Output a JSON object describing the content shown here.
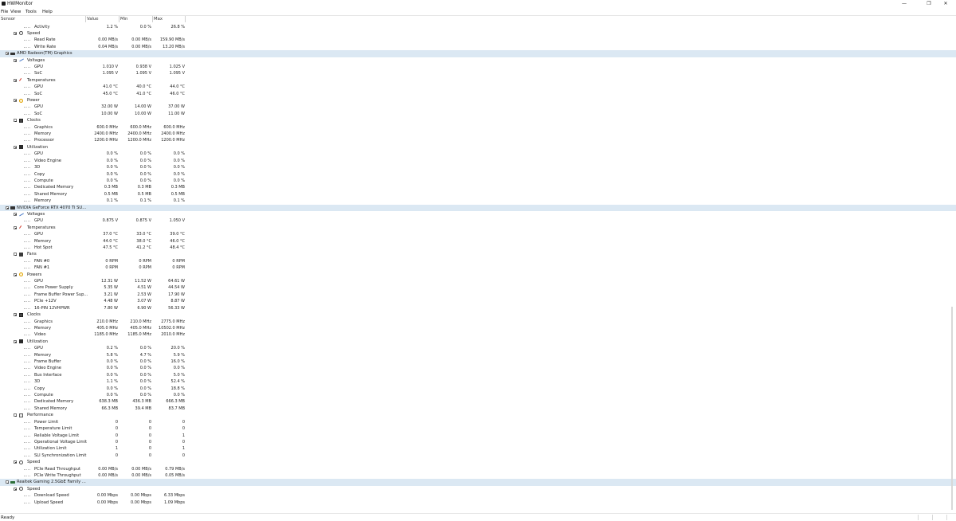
{
  "window": {
    "title": "HWMonitor",
    "minimize": "—",
    "maximize": "❐",
    "close": "✕"
  },
  "menu": [
    "File",
    "View",
    "Tools",
    "Help"
  ],
  "columns": {
    "sensor": "Sensor",
    "value": "Value",
    "min": "Min",
    "max": "Max"
  },
  "rows": [
    {
      "kind": "sensor",
      "indent": 3,
      "label": "Activity",
      "value": "1.2 %",
      "min": "0.0 %",
      "max": "26.8 %"
    },
    {
      "kind": "group",
      "icon": "speed-icon",
      "label": "Speed"
    },
    {
      "kind": "sensor",
      "indent": 3,
      "label": "Read Rate",
      "value": "0.00 MB/s",
      "min": "0.00 MB/s",
      "max": "159.90 MB/s"
    },
    {
      "kind": "sensor",
      "indent": 3,
      "label": "Write Rate",
      "value": "0.04 MB/s",
      "min": "0.00 MB/s",
      "max": "13.20 MB/s"
    },
    {
      "kind": "device",
      "icon": "gpu-card-icon",
      "label": "AMD Radeon(TM) Graphics"
    },
    {
      "kind": "group",
      "icon": "voltage-icon",
      "label": "Voltages"
    },
    {
      "kind": "sensor",
      "indent": 3,
      "label": "GPU",
      "value": "1.010 V",
      "min": "0.938 V",
      "max": "1.025 V"
    },
    {
      "kind": "sensor",
      "indent": 3,
      "label": "SoC",
      "value": "1.095 V",
      "min": "1.095 V",
      "max": "1.095 V"
    },
    {
      "kind": "group",
      "icon": "temperature-icon",
      "label": "Temperatures"
    },
    {
      "kind": "sensor",
      "indent": 3,
      "label": "GPU",
      "value": "41.0 °C",
      "min": "40.0 °C",
      "max": "44.0 °C"
    },
    {
      "kind": "sensor",
      "indent": 3,
      "label": "SoC",
      "value": "45.0 °C",
      "min": "41.0 °C",
      "max": "46.0 °C"
    },
    {
      "kind": "group",
      "icon": "power-icon",
      "label": "Power"
    },
    {
      "kind": "sensor",
      "indent": 3,
      "label": "GPU",
      "value": "32.00 W",
      "min": "14.00 W",
      "max": "37.00 W"
    },
    {
      "kind": "sensor",
      "indent": 3,
      "label": "SoC",
      "value": "10.00 W",
      "min": "10.00 W",
      "max": "11.00 W"
    },
    {
      "kind": "group",
      "icon": "clock-icon",
      "label": "Clocks"
    },
    {
      "kind": "sensor",
      "indent": 3,
      "label": "Graphics",
      "value": "600.0 MHz",
      "min": "600.0 MHz",
      "max": "600.0 MHz"
    },
    {
      "kind": "sensor",
      "indent": 3,
      "label": "Memory",
      "value": "2400.0 MHz",
      "min": "2400.0 MHz",
      "max": "2400.0 MHz"
    },
    {
      "kind": "sensor",
      "indent": 3,
      "label": "Processor",
      "value": "1200.0 MHz",
      "min": "1200.0 MHz",
      "max": "1200.0 MHz"
    },
    {
      "kind": "group",
      "icon": "utilization-icon",
      "label": "Utilization"
    },
    {
      "kind": "sensor",
      "indent": 3,
      "label": "GPU",
      "value": "0.0 %",
      "min": "0.0 %",
      "max": "0.0 %"
    },
    {
      "kind": "sensor",
      "indent": 3,
      "label": "Video Engine",
      "value": "0.0 %",
      "min": "0.0 %",
      "max": "0.0 %"
    },
    {
      "kind": "sensor",
      "indent": 3,
      "label": "3D",
      "value": "0.0 %",
      "min": "0.0 %",
      "max": "0.0 %"
    },
    {
      "kind": "sensor",
      "indent": 3,
      "label": "Copy",
      "value": "0.0 %",
      "min": "0.0 %",
      "max": "0.0 %"
    },
    {
      "kind": "sensor",
      "indent": 3,
      "label": "Compute",
      "value": "0.0 %",
      "min": "0.0 %",
      "max": "0.0 %"
    },
    {
      "kind": "sensor",
      "indent": 3,
      "label": "Dedicated Memory",
      "value": "0.3 MB",
      "min": "0.3 MB",
      "max": "0.3 MB"
    },
    {
      "kind": "sensor",
      "indent": 3,
      "label": "Shared Memory",
      "value": "0.5 MB",
      "min": "0.5 MB",
      "max": "0.5 MB"
    },
    {
      "kind": "sensor",
      "indent": 3,
      "label": "Memory",
      "value": "0.1 %",
      "min": "0.1 %",
      "max": "0.1 %"
    },
    {
      "kind": "device",
      "icon": "gpu-card-icon",
      "label": "NVIDIA GeForce RTX 4070 Ti SU..."
    },
    {
      "kind": "group",
      "icon": "voltage-icon",
      "label": "Voltages"
    },
    {
      "kind": "sensor",
      "indent": 3,
      "label": "GPU",
      "value": "0.875 V",
      "min": "0.875 V",
      "max": "1.050 V"
    },
    {
      "kind": "group",
      "icon": "temperature-icon",
      "label": "Temperatures"
    },
    {
      "kind": "sensor",
      "indent": 3,
      "label": "GPU",
      "value": "37.0 °C",
      "min": "33.0 °C",
      "max": "39.0 °C"
    },
    {
      "kind": "sensor",
      "indent": 3,
      "label": "Memory",
      "value": "44.0 °C",
      "min": "38.0 °C",
      "max": "46.0 °C"
    },
    {
      "kind": "sensor",
      "indent": 3,
      "label": "Hot Spot",
      "value": "47.5 °C",
      "min": "41.2 °C",
      "max": "48.4 °C"
    },
    {
      "kind": "group",
      "icon": "fan-icon",
      "label": "Fans"
    },
    {
      "kind": "sensor",
      "indent": 3,
      "label": "FAN #0",
      "value": "0 RPM",
      "min": "0 RPM",
      "max": "0 RPM"
    },
    {
      "kind": "sensor",
      "indent": 3,
      "label": "FAN #1",
      "value": "0 RPM",
      "min": "0 RPM",
      "max": "0 RPM"
    },
    {
      "kind": "group",
      "icon": "power-icon",
      "label": "Powers"
    },
    {
      "kind": "sensor",
      "indent": 3,
      "label": "GPU",
      "value": "12.31 W",
      "min": "11.52 W",
      "max": "64.61 W"
    },
    {
      "kind": "sensor",
      "indent": 3,
      "label": "Core Power Supply",
      "value": "5.35 W",
      "min": "4.51 W",
      "max": "44.54 W"
    },
    {
      "kind": "sensor",
      "indent": 3,
      "label": "Frame Buffer Power Sup...",
      "value": "3.21 W",
      "min": "2.53 W",
      "max": "17.90 W"
    },
    {
      "kind": "sensor",
      "indent": 3,
      "label": "PCIe +12V",
      "value": "4.48 W",
      "min": "3.07 W",
      "max": "8.87 W"
    },
    {
      "kind": "sensor",
      "indent": 3,
      "label": "16-PIN 12VHPWR",
      "value": "7.80 W",
      "min": "6.90 W",
      "max": "56.33 W"
    },
    {
      "kind": "group",
      "icon": "clock-icon",
      "label": "Clocks"
    },
    {
      "kind": "sensor",
      "indent": 3,
      "label": "Graphics",
      "value": "210.0 MHz",
      "min": "210.0 MHz",
      "max": "2775.0 MHz"
    },
    {
      "kind": "sensor",
      "indent": 3,
      "label": "Memory",
      "value": "405.0 MHz",
      "min": "405.0 MHz",
      "max": "10502.0 MHz"
    },
    {
      "kind": "sensor",
      "indent": 3,
      "label": "Video",
      "value": "1185.0 MHz",
      "min": "1185.0 MHz",
      "max": "2010.0 MHz"
    },
    {
      "kind": "group",
      "icon": "utilization-icon",
      "label": "Utilization"
    },
    {
      "kind": "sensor",
      "indent": 3,
      "label": "GPU",
      "value": "0.2 %",
      "min": "0.0 %",
      "max": "20.0 %"
    },
    {
      "kind": "sensor",
      "indent": 3,
      "label": "Memory",
      "value": "5.8 %",
      "min": "4.7 %",
      "max": "5.9 %"
    },
    {
      "kind": "sensor",
      "indent": 3,
      "label": "Frame Buffer",
      "value": "0.0 %",
      "min": "0.0 %",
      "max": "16.0 %"
    },
    {
      "kind": "sensor",
      "indent": 3,
      "label": "Video Engine",
      "value": "0.0 %",
      "min": "0.0 %",
      "max": "0.0 %"
    },
    {
      "kind": "sensor",
      "indent": 3,
      "label": "Bus Interface",
      "value": "0.0 %",
      "min": "0.0 %",
      "max": "5.0 %"
    },
    {
      "kind": "sensor",
      "indent": 3,
      "label": "3D",
      "value": "1.1 %",
      "min": "0.0 %",
      "max": "52.4 %"
    },
    {
      "kind": "sensor",
      "indent": 3,
      "label": "Copy",
      "value": "0.0 %",
      "min": "0.0 %",
      "max": "18.8 %"
    },
    {
      "kind": "sensor",
      "indent": 3,
      "label": "Compute",
      "value": "0.0 %",
      "min": "0.0 %",
      "max": "0.0 %"
    },
    {
      "kind": "sensor",
      "indent": 3,
      "label": "Dedicated Memory",
      "value": "638.3 MB",
      "min": "436.3 MB",
      "max": "666.3 MB"
    },
    {
      "kind": "sensor",
      "indent": 3,
      "label": "Shared Memory",
      "value": "66.3 MB",
      "min": "39.4 MB",
      "max": "83.7 MB"
    },
    {
      "kind": "group",
      "icon": "performance-icon",
      "label": "Performance"
    },
    {
      "kind": "sensor",
      "indent": 3,
      "label": "Power Limit",
      "value": "0",
      "min": "0",
      "max": "0"
    },
    {
      "kind": "sensor",
      "indent": 3,
      "label": "Temperature Limit",
      "value": "0",
      "min": "0",
      "max": "0"
    },
    {
      "kind": "sensor",
      "indent": 3,
      "label": "Reliable Voltage Limit",
      "value": "0",
      "min": "0",
      "max": "1"
    },
    {
      "kind": "sensor",
      "indent": 3,
      "label": "Operational Voltage Limit",
      "value": "0",
      "min": "0",
      "max": "0"
    },
    {
      "kind": "sensor",
      "indent": 3,
      "label": "Utilization Limit",
      "value": "1",
      "min": "0",
      "max": "1"
    },
    {
      "kind": "sensor",
      "indent": 3,
      "label": "SLI Synchronization Limit",
      "value": "0",
      "min": "0",
      "max": "0"
    },
    {
      "kind": "group",
      "icon": "speed-icon",
      "label": "Speed"
    },
    {
      "kind": "sensor",
      "indent": 3,
      "label": "PCIe Read Throughput",
      "value": "0.00 MB/s",
      "min": "0.00 MB/s",
      "max": "0.79 MB/s"
    },
    {
      "kind": "sensor",
      "indent": 3,
      "label": "PCIe Write Throughput",
      "value": "0.00 MB/s",
      "min": "0.00 MB/s",
      "max": "0.05 MB/s"
    },
    {
      "kind": "device",
      "icon": "network-adapter-icon",
      "label": "Realtek Gaming 2.5GbE Family ..."
    },
    {
      "kind": "group",
      "icon": "speed-icon",
      "label": "Speed"
    },
    {
      "kind": "sensor",
      "indent": 3,
      "label": "Download Speed",
      "value": "0.00 Mbps",
      "min": "0.00 Mbps",
      "max": "6.33 Mbps"
    },
    {
      "kind": "sensor",
      "indent": 3,
      "label": "Upload Speed",
      "value": "0.00 Mbps",
      "min": "0.00 Mbps",
      "max": "1.09 Mbps"
    }
  ],
  "status": {
    "text": "Ready"
  },
  "colors": {
    "section_highlight": "#dbe8f3",
    "tree_line": "#b8b8b8"
  }
}
